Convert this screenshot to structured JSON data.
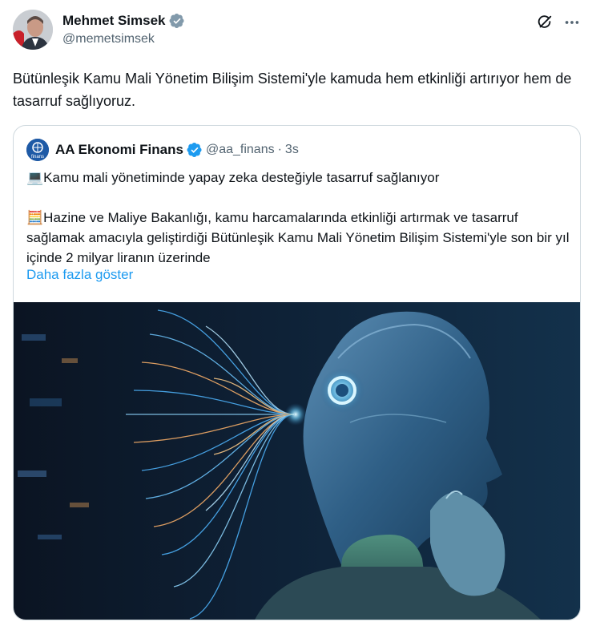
{
  "author": {
    "name": "Mehmet Simsek",
    "handle": "@memetsimsek",
    "verified_color": "#829aab"
  },
  "tweet": {
    "text": "Bütünleşik Kamu Mali Yönetim Bilişim Sistemi'yle kamuda hem etkinliği artırıyor hem de tasarruf sağlıyoruz."
  },
  "actions": {
    "grok_icon": "grok-icon",
    "more_icon": "more-icon"
  },
  "quote": {
    "name": "AA Ekonomi Finans",
    "handle": "@aa_finans",
    "separator": "·",
    "time": "3s",
    "verified_color": "#1d9bf0",
    "avatar_text": "finans",
    "line1_emoji": "💻",
    "line1": "Kamu mali yönetiminde yapay zeka desteğiyle tasarruf sağlanıyor",
    "line2_emoji": "🧮",
    "line2": "Hazine ve Maliye Bakanlığı, kamu harcamalarında etkinliği artırmak ve tasarruf sağlamak amacıyla geliştirdiği Bütünleşik Kamu Mali Yönetim Bilişim Sistemi'yle son bir yıl içinde 2 milyar liranın üzerinde",
    "show_more": "Daha fazla göster"
  },
  "colors": {
    "link": "#1d9bf0",
    "secondary_text": "#536471",
    "border": "#cfd9de"
  }
}
